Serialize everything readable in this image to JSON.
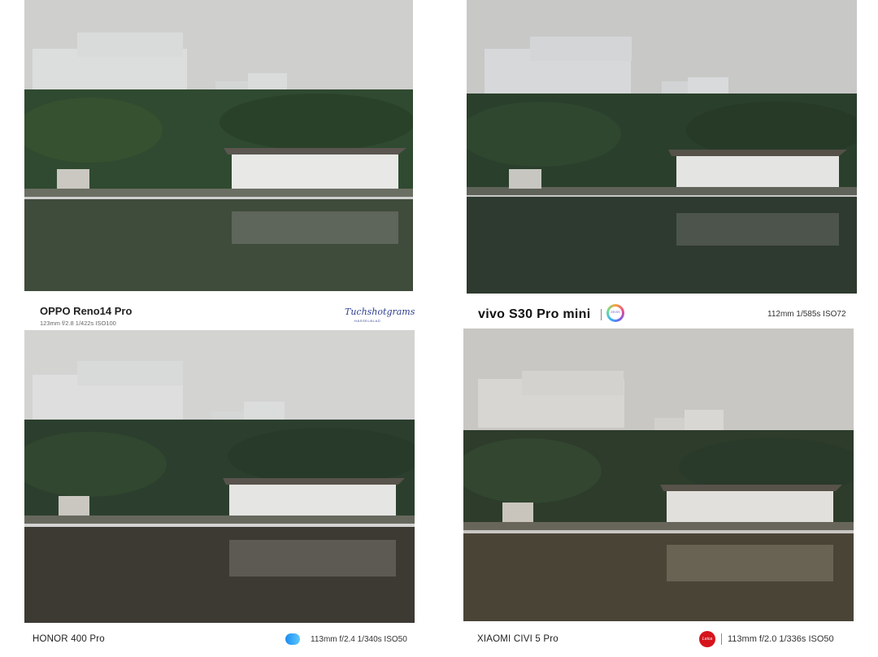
{
  "panels": [
    {
      "id": "oppo",
      "model": "OPPO Reno14 Pro",
      "specs": "123mm  f/2.8  1/422s  ISO100",
      "signature": "Tuchshotgrams",
      "signature_sub": "HASSELBLAD",
      "photo_tone": {
        "sky": "#cfcfce",
        "trees": "#2f4a30",
        "water": "#3f4b3b",
        "building": "#dcdedd"
      }
    },
    {
      "id": "vivo",
      "model": "vivo S30 Pro mini",
      "specs": "112mm  1/585s  ISO72",
      "logo_text": "ZEISS",
      "photo_tone": {
        "sky": "#c8c8c7",
        "trees": "#2a3f2c",
        "water": "#2e3a2f",
        "building": "#d6d8d9"
      }
    },
    {
      "id": "honor",
      "model": "HONOR 400 Pro",
      "specs": "113mm  f/2.4  1/340s  ISO50",
      "photo_tone": {
        "sky": "#d3d3d2",
        "trees": "#2c3f2e",
        "water": "#3c3a33",
        "building": "#dddedd"
      }
    },
    {
      "id": "xiaomi",
      "model": "XIAOMI CIVI 5 Pro",
      "specs": "113mm  f/2.0  1/336s  ISO50",
      "logo_text": "Leica",
      "photo_tone": {
        "sky": "#c9c7c3",
        "trees": "#2d3c2b",
        "water": "#4a4437",
        "building": "#d8d6d2"
      }
    }
  ]
}
